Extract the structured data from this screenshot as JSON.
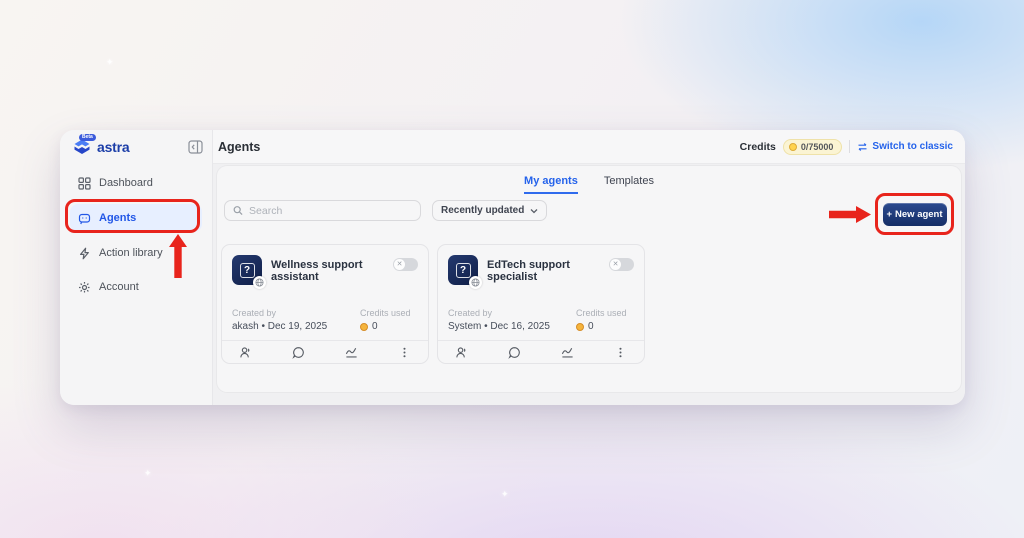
{
  "sidebar": {
    "logo": {
      "text": "astra",
      "badge": "Beta"
    },
    "items": [
      {
        "label": "Dashboard"
      },
      {
        "label": "Agents"
      },
      {
        "label": "Action library"
      },
      {
        "label": "Account"
      }
    ]
  },
  "header": {
    "title": "Agents",
    "credits_label": "Credits",
    "credits_value": "0/75000",
    "switch_to_classic": "Switch to classic"
  },
  "tabs": [
    {
      "label": "My agents"
    },
    {
      "label": "Templates"
    }
  ],
  "toolbar": {
    "search_placeholder": "Search",
    "sort_value": "Recently updated",
    "new_agent_plus": "+",
    "new_agent_label": "New agent"
  },
  "cards": [
    {
      "title": "Wellness support assistant",
      "avatar_glyph": "?",
      "toggle_state": "off",
      "created_by_label": "Created by",
      "created_by_value": "akash • Dec 19, 2025",
      "credits_used_label": "Credits used",
      "credits_used_value": "0"
    },
    {
      "title": "EdTech support specialist",
      "avatar_glyph": "?",
      "toggle_state": "off",
      "created_by_label": "Created by",
      "created_by_value": "System • Dec 16, 2025",
      "credits_used_label": "Credits used",
      "credits_used_value": "0"
    }
  ],
  "colors": {
    "accent_blue": "#2563eb",
    "annotation_red": "#e8241c",
    "button_navy": "#152e66",
    "credits_badge_bg": "#fbf4d3"
  }
}
